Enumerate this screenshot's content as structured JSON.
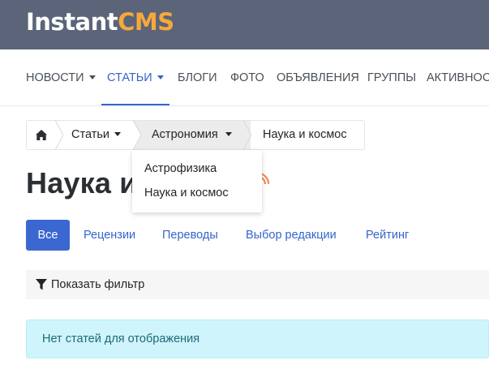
{
  "logo": {
    "part1": "Instant",
    "part2": "CMS"
  },
  "colors": {
    "topbar": "#5b6478",
    "accent": "#3465c9",
    "logo_accent": "#f5a93b",
    "rss": "#f08a5a"
  },
  "nav": {
    "items": [
      {
        "label": "НОВОСТИ"
      },
      {
        "label": "СТАТЬИ"
      },
      {
        "label": "БЛОГИ"
      },
      {
        "label": "ФОТО"
      },
      {
        "label": "ОБЪЯВЛЕНИЯ"
      },
      {
        "label": "ГРУППЫ"
      },
      {
        "label": "АКТИВНОСТЬ"
      }
    ]
  },
  "breadcrumb": {
    "home_icon": "home-icon",
    "items": [
      {
        "label": "Статьи"
      },
      {
        "label": "Астрономия"
      },
      {
        "label": "Наука и космос"
      }
    ]
  },
  "dropdown": {
    "items": [
      {
        "label": "Астрофизика"
      },
      {
        "label": "Наука и космос"
      }
    ]
  },
  "page": {
    "title": "Наука и космос",
    "rss_icon": "rss-icon"
  },
  "tabs": [
    {
      "label": "Все"
    },
    {
      "label": "Рецензии"
    },
    {
      "label": "Переводы"
    },
    {
      "label": "Выбор редакции"
    },
    {
      "label": "Рейтинг"
    }
  ],
  "filter": {
    "icon": "filter-icon",
    "label": "Показать фильтр"
  },
  "alert": {
    "text": "Нет статей для отображения"
  }
}
